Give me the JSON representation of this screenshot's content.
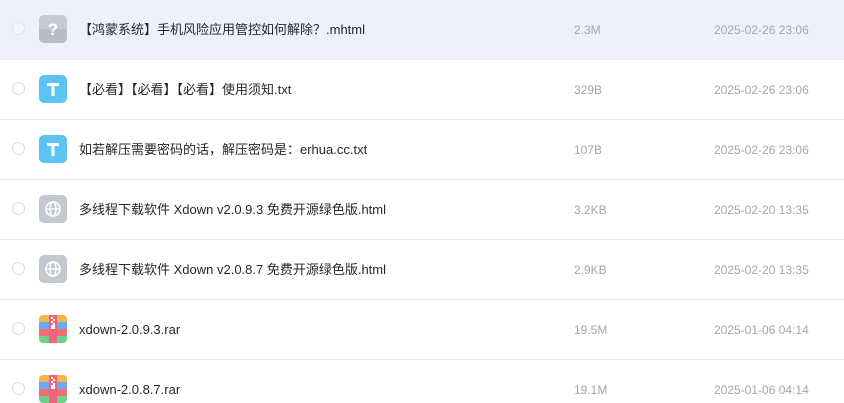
{
  "files": [
    {
      "name": "【鸿蒙系统】手机风险应用管控如何解除？.mhtml",
      "size": "2.3M",
      "date": "2025-02-26 23:06",
      "icon": "unknown-file-icon",
      "selected": true
    },
    {
      "name": "【必看】【必看】【必看】使用须知.txt",
      "size": "329B",
      "date": "2025-02-26 23:06",
      "icon": "text-file-icon",
      "selected": false
    },
    {
      "name": "如若解压需要密码的话，解压密码是：erhua.cc.txt",
      "size": "107B",
      "date": "2025-02-26 23:06",
      "icon": "text-file-icon",
      "selected": false
    },
    {
      "name": "多线程下载软件 Xdown v2.0.9.3 免费开源绿色版.html",
      "size": "3.2KB",
      "date": "2025-02-20 13:35",
      "icon": "web-file-icon",
      "selected": false
    },
    {
      "name": "多线程下载软件 Xdown v2.0.8.7 免费开源绿色版.html",
      "size": "2.9KB",
      "date": "2025-02-20 13:35",
      "icon": "web-file-icon",
      "selected": false
    },
    {
      "name": "xdown-2.0.9.3.rar",
      "size": "19.5M",
      "date": "2025-01-06 04:14",
      "icon": "archive-file-icon",
      "selected": false
    },
    {
      "name": "xdown-2.0.8.7.rar",
      "size": "19.1M",
      "date": "2025-01-06 04:14",
      "icon": "archive-file-icon",
      "selected": false
    }
  ],
  "colors": {
    "selected_row": "#eef1fd",
    "text_icon": "#5bc4f3",
    "unknown_icon": "#b5b9c3",
    "web_icon": "#c2c6d0",
    "archive_colors": [
      "#f3b64c",
      "#6fa8f2",
      "#f36c78",
      "#6fd08a"
    ]
  }
}
